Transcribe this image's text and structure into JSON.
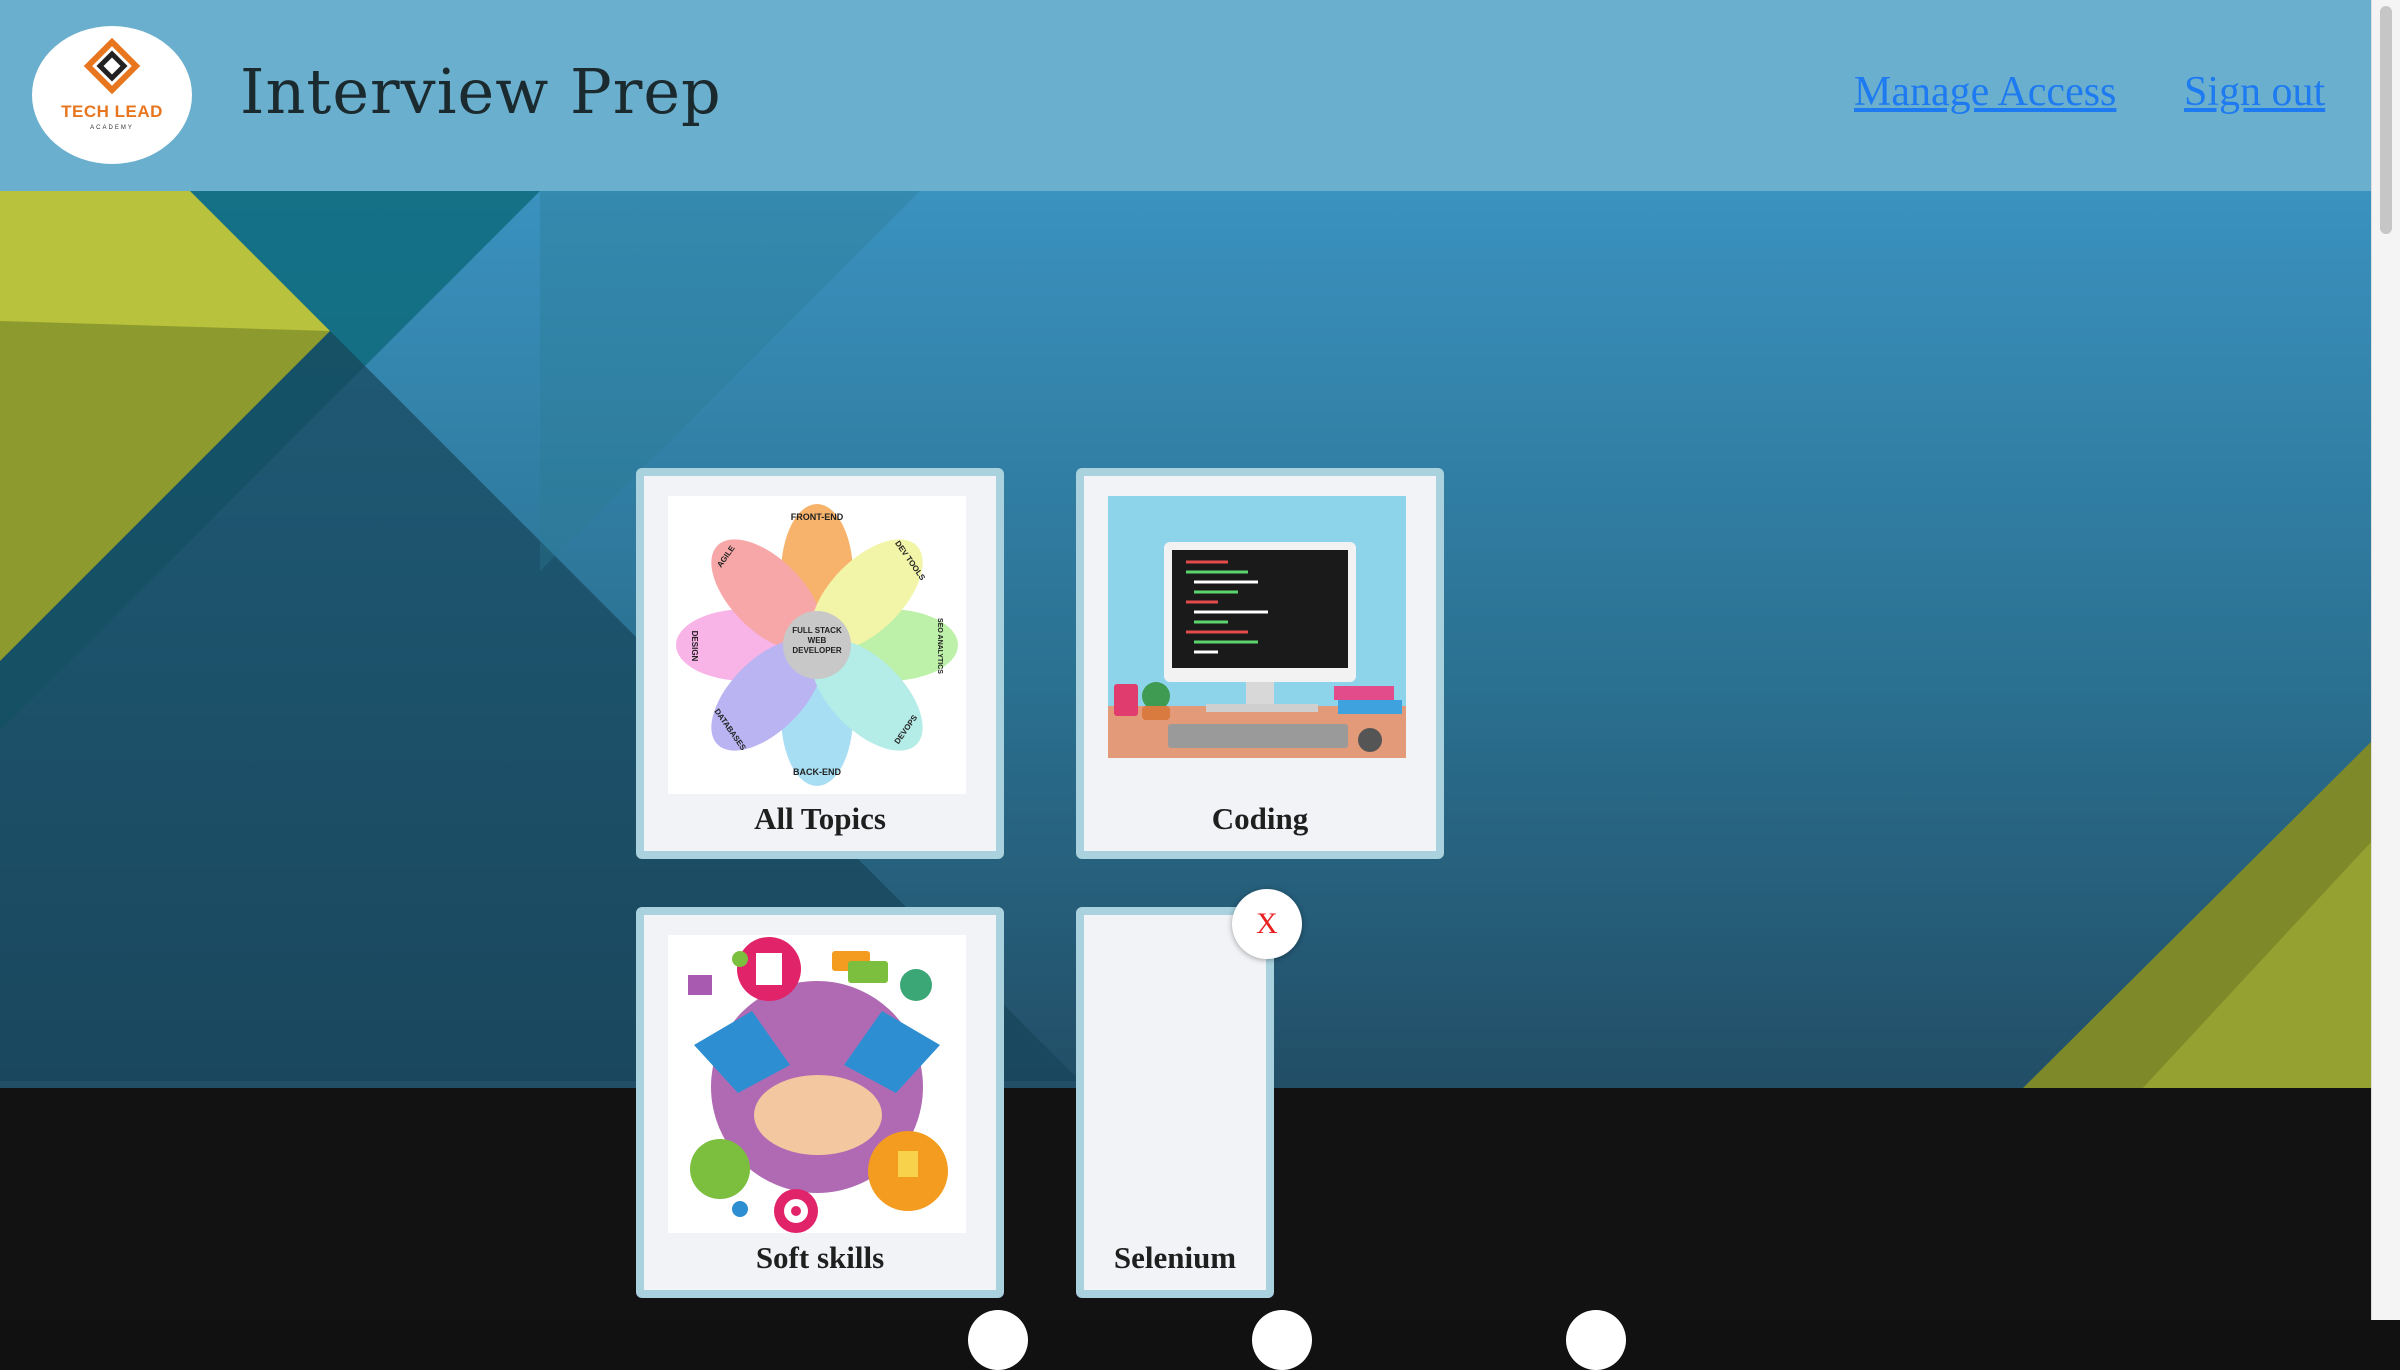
{
  "header": {
    "logo_text": "TECH LEAD",
    "logo_subtext": "ACADEMY",
    "title": "Interview Prep",
    "manage_access_label": "Manage Access",
    "sign_out_label": "Sign out"
  },
  "topics": [
    {
      "label": "All Topics",
      "image": "full-stack-petal-diagram"
    },
    {
      "label": "Coding",
      "image": "computer-desk-illustration"
    },
    {
      "label": "Soft skills",
      "image": "handshake-illustration"
    },
    {
      "label": "Selenium",
      "image": "none"
    }
  ],
  "petals": {
    "center": "FULL STACK WEB DEVELOPER",
    "front_end": "FRONT-END",
    "dev_tools": "DEV TOOLS",
    "seo": "SEO ANALYTICS",
    "devops": "DEVOPS",
    "back_end": "BACK-END",
    "databases": "DATABASES",
    "design": "DESIGN",
    "agile": "AGILE"
  },
  "delete_label": "X",
  "colors": {
    "header_bg": "#6aafce",
    "link": "#1d7af0",
    "card_border": "#a9d1de",
    "delete_x": "#e81f1f"
  }
}
